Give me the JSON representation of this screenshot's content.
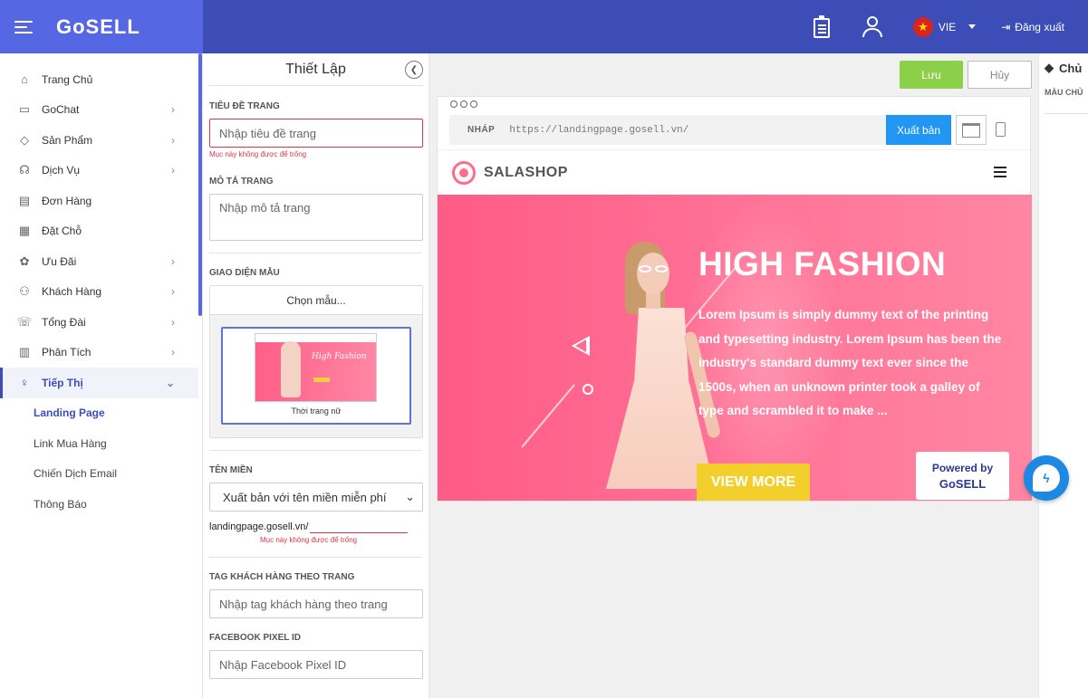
{
  "app": {
    "logo": "GoSELL"
  },
  "topbar": {
    "language": "VIE",
    "logout_label": "Đăng xuất",
    "icons": [
      "clipboard-icon",
      "support-user-icon"
    ]
  },
  "sidebar": {
    "items": [
      {
        "label": "Trang Chủ",
        "icon": "home-icon"
      },
      {
        "label": "GoChat",
        "icon": "chat-icon"
      },
      {
        "label": "Sản Phẩm",
        "icon": "tag-icon"
      },
      {
        "label": "Dịch Vụ",
        "icon": "service-icon"
      },
      {
        "label": "Đơn Hàng",
        "icon": "order-icon"
      },
      {
        "label": "Đặt Chỗ",
        "icon": "calendar-icon"
      },
      {
        "label": "Ưu Đãi",
        "icon": "discount-icon"
      },
      {
        "label": "Khách Hàng",
        "icon": "customers-icon"
      },
      {
        "label": "Tổng Đài",
        "icon": "phone-icon"
      },
      {
        "label": "Phân Tích",
        "icon": "chart-icon"
      },
      {
        "label": "Tiếp Thị",
        "icon": "bulb-icon"
      }
    ],
    "submenu": [
      "Landing Page",
      "Link Mua Hàng",
      "Chiến Dịch Email",
      "Thông Báo"
    ]
  },
  "settings": {
    "title": "Thiết Lập",
    "page_title_label": "TIÊU ĐỀ TRANG",
    "page_title_placeholder": "Nhập tiêu đề trang",
    "page_title_error": "Mục này không được để trống",
    "description_label": "MÔ TẢ TRANG",
    "description_placeholder": "Nhập mô tả trang",
    "template_label": "GIAO DIỆN MẪU",
    "template_choose": "Chọn mẫu...",
    "template_name": "Thời trang nữ",
    "template_thumb_text": "High Fashion",
    "domain_label": "TÊN MIỀN",
    "domain_option": "Xuất bản với tên miền miễn phí",
    "domain_prefix": "landingpage.gosell.vn/",
    "domain_error": "Mục này không được để trống",
    "tag_label": "TAG KHÁCH HÀNG THEO TRANG",
    "tag_placeholder": "Nhập tag khách hàng theo trang",
    "pixel_label": "FACEBOOK PIXEL ID",
    "pixel_placeholder": "Nhập Facebook Pixel ID"
  },
  "actions": {
    "save": "Lưu",
    "cancel": "Hủy"
  },
  "preview": {
    "url_tag": "NHÁP",
    "url": "https://landingpage.gosell.vn/",
    "publish": "Xuất bản",
    "site_name": "SALASHOP",
    "hero_title": "HIGH FASHION",
    "hero_desc": "Lorem Ipsum is simply dummy text of the printing and typesetting industry. Lorem Ipsum has been the industry's standard dummy text ever since the 1500s, when an unknown printer took a galley of type and scrambled it to make ...",
    "cta": "VIEW MORE",
    "powered_by": "Powered by",
    "powered_logo": "GoSELL"
  },
  "right_panel": {
    "title": "Chủ",
    "label": "MÀU CHỦ"
  }
}
